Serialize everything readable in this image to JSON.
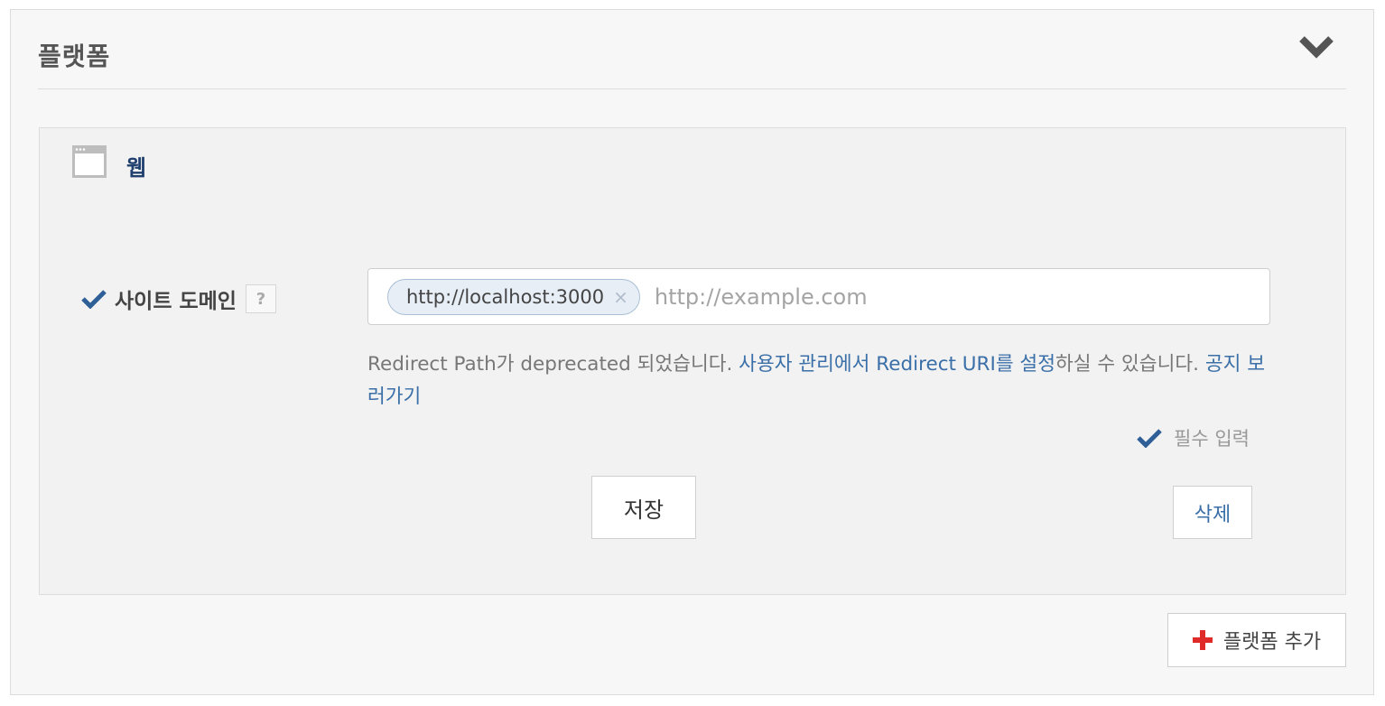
{
  "section": {
    "title": "플랫폼"
  },
  "platform": {
    "name": "웹",
    "icon": "browser-window-icon",
    "site_domain": {
      "label": "사이트 도메인",
      "help": "?",
      "tags": [
        {
          "value": "http://localhost:3000",
          "remove": "×"
        }
      ],
      "placeholder": "http://example.com"
    },
    "notice": {
      "text_before": "Redirect Path가 deprecated 되었습니다. ",
      "link_settings": "사용자 관리에서 Redirect URI를 설정",
      "text_after": "하실 수 있습니다. ",
      "link_notice": "공지 보러가기"
    },
    "required_label": "필수 입력",
    "save_label": "저장",
    "delete_label": "삭제"
  },
  "add_platform": {
    "label": "플랫폼 추가",
    "icon": "plus-icon"
  },
  "colors": {
    "accent": "#3a6fa8",
    "check": "#2f5f97",
    "plus": "#e02b2b",
    "web_label": "#1f3f6e"
  }
}
